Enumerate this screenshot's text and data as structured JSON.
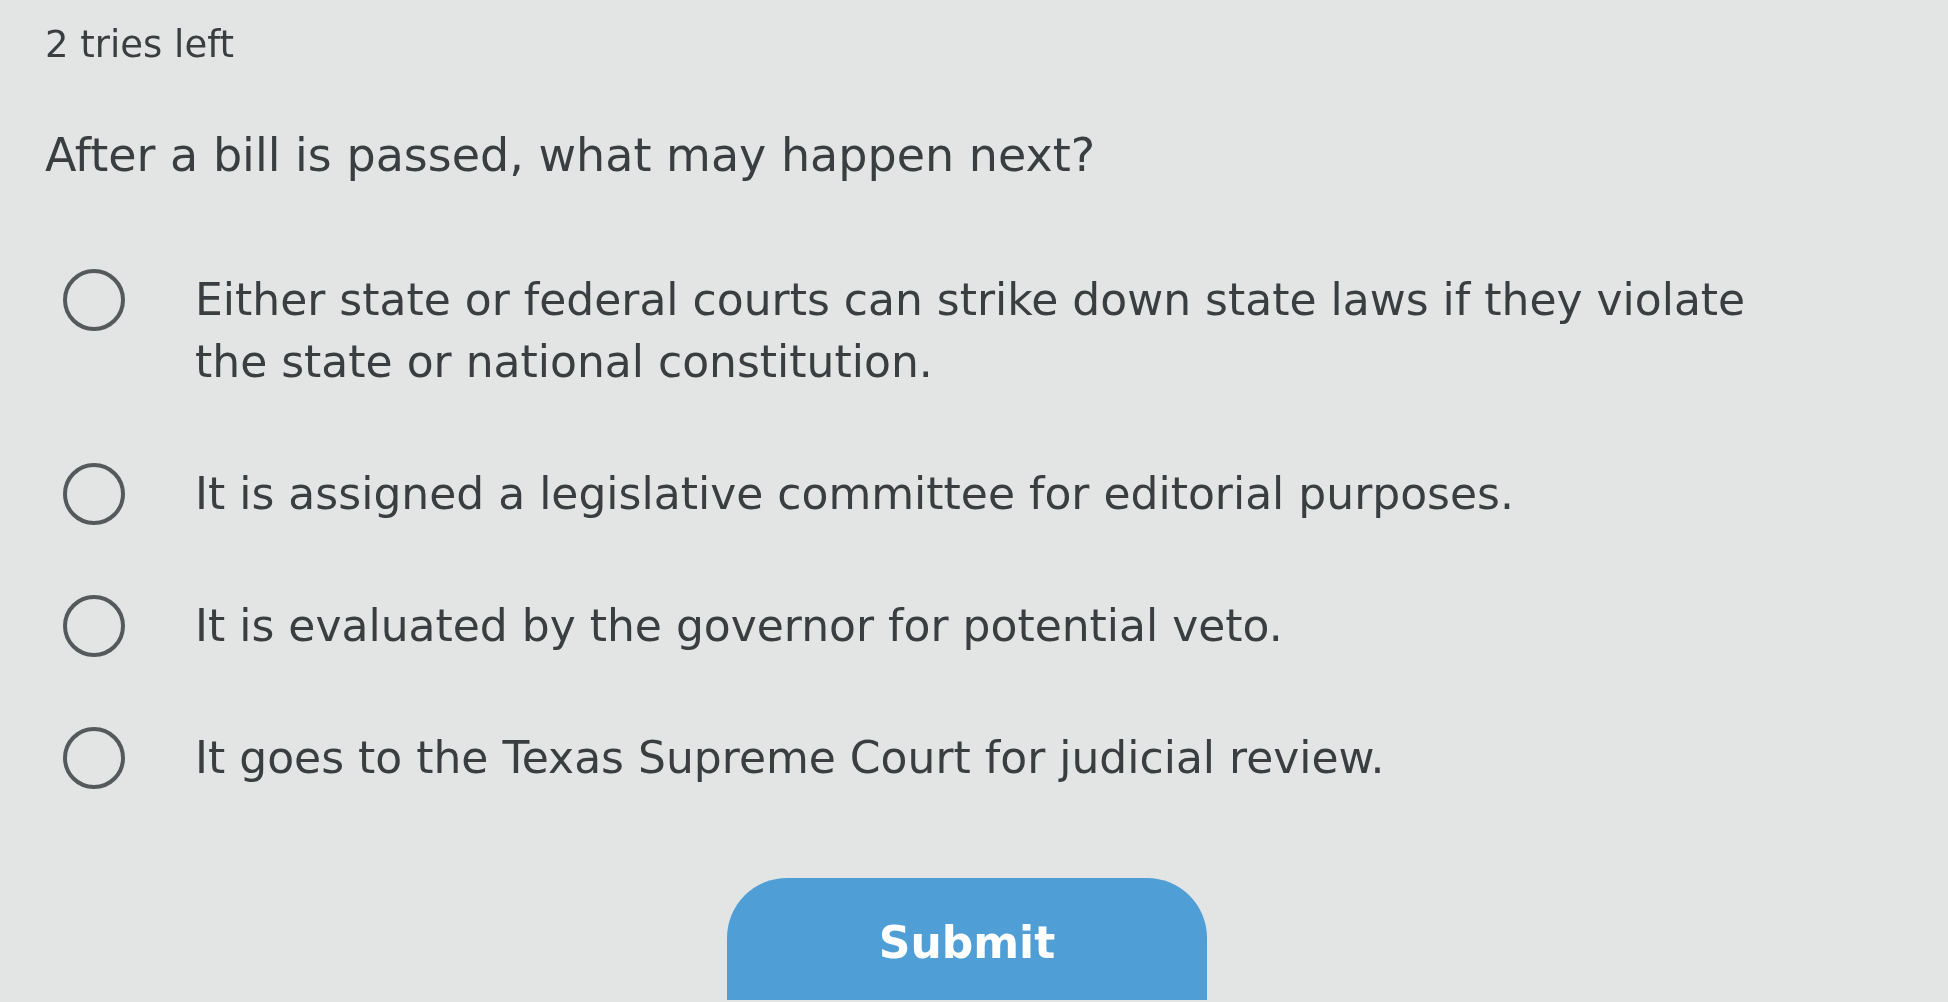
{
  "tries": "2 tries left",
  "question": "After a bill is passed, what may happen next?",
  "options": [
    {
      "label": "Either state or federal courts can strike down state laws if they violate the state or national constitution.",
      "selected": false
    },
    {
      "label": "It is assigned a legislative committee for editorial purposes.",
      "selected": false
    },
    {
      "label": "It is evaluated by the governor for potential veto.",
      "selected": false
    },
    {
      "label": "It goes to the Texas Supreme Court for judicial review.",
      "selected": false
    }
  ],
  "submit": {
    "label": "Submit"
  }
}
